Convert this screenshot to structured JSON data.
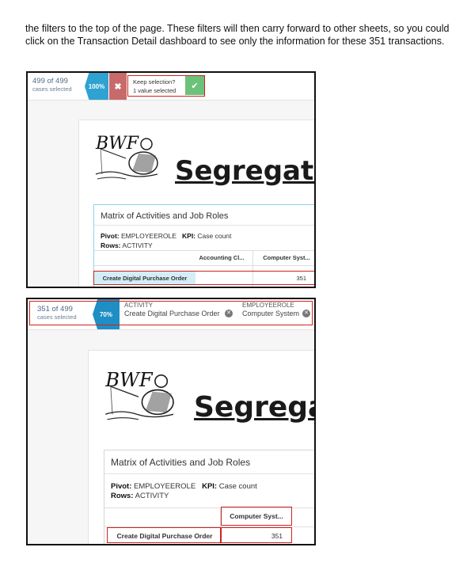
{
  "intro": {
    "text": "the filters to the top of the page. These filters will then carry forward to other sheets, so you could click on the Transaction Detail dashboard to see only the information for these 351 transactions."
  },
  "shot1": {
    "cases_count": "499 of 499",
    "cases_label": "cases selected",
    "percent": "100%",
    "reject_symbol": "✖",
    "keep_line1": "Keep selection?",
    "keep_line2": "1 value selected",
    "accept_symbol": "✔",
    "logo_text": "BWF",
    "title": "Segregatio",
    "matrix_title": "Matrix of Activities and Job Roles",
    "pivot_label": "Pivot:",
    "pivot_value": "EMPLOYEEROLE",
    "kpi_label": "KPI:",
    "kpi_value": "Case count",
    "rows_label": "Rows:",
    "rows_value": "ACTIVITY",
    "col1": "Accounting Cl...",
    "col2": "Computer Syst...",
    "row_label": "Create Digital Purchase Order",
    "cell_value": "351"
  },
  "shot2": {
    "cases_count": "351 of 499",
    "cases_label": "cases selected",
    "percent": "70%",
    "filter1_label": "ACTIVITY",
    "filter1_value": "Create Digital Purchase Order",
    "filter2_label": "EMPLOYEEROLE",
    "filter2_value": "Computer System",
    "logo_text": "BWF",
    "title": "Segrega",
    "matrix_title": "Matrix of Activities and Job Roles",
    "pivot_label": "Pivot:",
    "pivot_value": "EMPLOYEEROLE",
    "kpi_label": "KPI:",
    "kpi_value": "Case count",
    "rows_label": "Rows:",
    "rows_value": "ACTIVITY",
    "col1": "Computer Syst...",
    "row_label": "Create Digital Purchase Order",
    "cell_value": "351"
  },
  "colors": {
    "highlight": "#d0221f",
    "percent_bg": "#2ea2d1",
    "reject_bg": "#c96a6a",
    "accept_bg": "#6cc27a",
    "selected_row_bg": "#d4edf7"
  }
}
